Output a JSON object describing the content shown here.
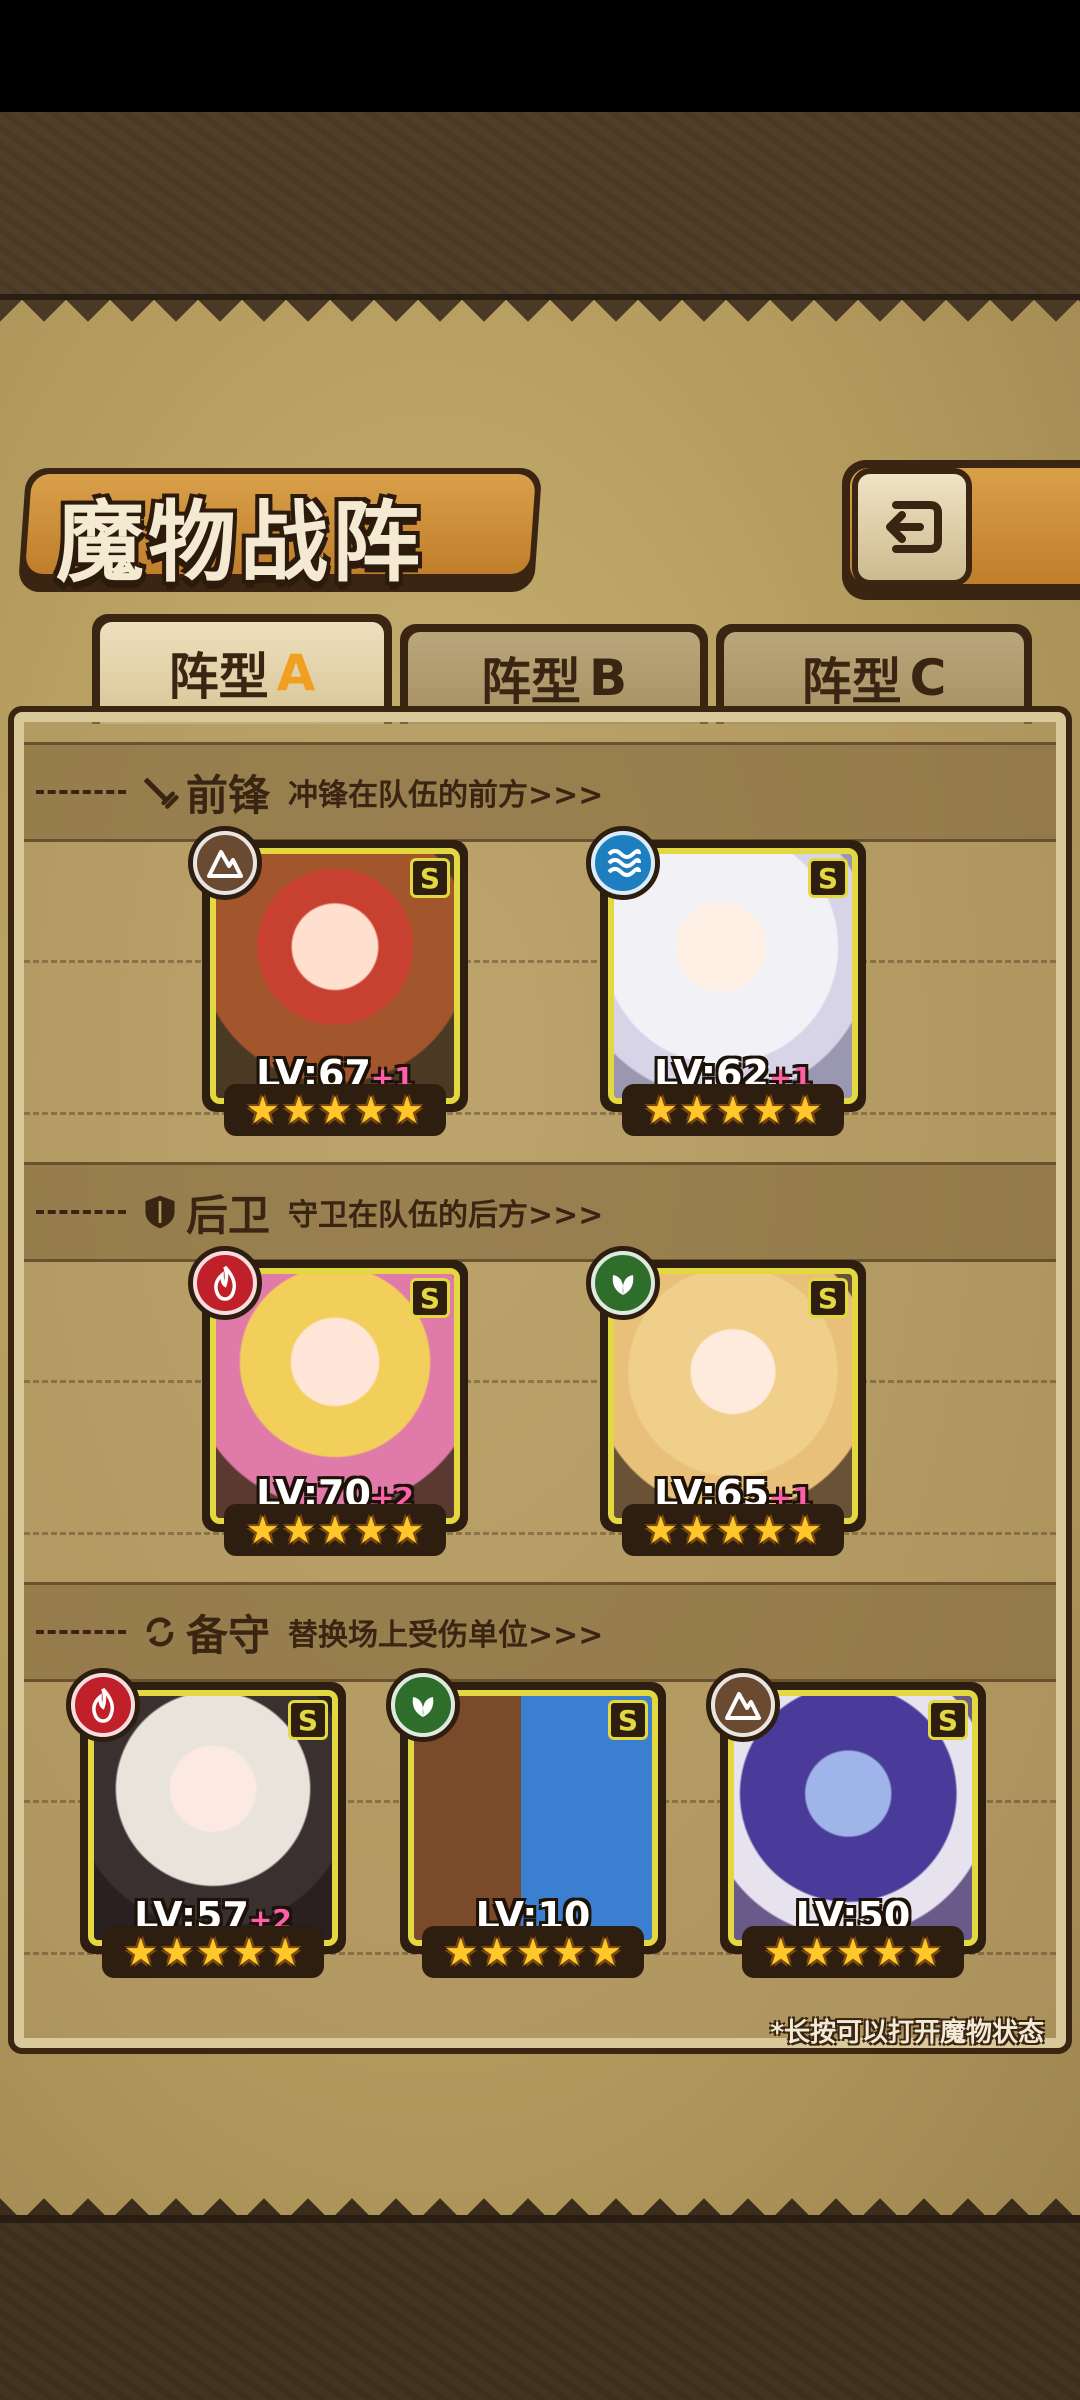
{
  "title": "魔物战阵",
  "tabs": [
    {
      "label": "阵型",
      "letter": "A",
      "active": true
    },
    {
      "label": "阵型",
      "letter": "B",
      "active": false
    },
    {
      "label": "阵型",
      "letter": "C",
      "active": false
    }
  ],
  "sections": {
    "front": {
      "name": "前锋",
      "desc": "冲锋在队伍的前方>>>",
      "icon": "sword-icon"
    },
    "rear": {
      "name": "后卫",
      "desc": "守卫在队伍的后方>>>",
      "icon": "shield-icon"
    },
    "reserve": {
      "name": "备守",
      "desc": "替换场上受伤单位>>>",
      "icon": "swap-icon"
    }
  },
  "monsters": {
    "front_1": {
      "rank": "S",
      "level": "LV:67",
      "bonus": "+1",
      "element": "earth-icon",
      "element_color": "#6b4a32",
      "stars": 5
    },
    "front_2": {
      "rank": "S",
      "level": "LV:62",
      "bonus": "+1",
      "element": "water-icon",
      "element_color": "#1e7fc0",
      "stars": 5
    },
    "rear_1": {
      "rank": "S",
      "level": "LV:70",
      "bonus": "+2",
      "element": "fire-icon",
      "element_color": "#c0202a",
      "stars": 5
    },
    "rear_2": {
      "rank": "S",
      "level": "LV:65",
      "bonus": "+1",
      "element": "wind-icon",
      "element_color": "#2e6e2a",
      "stars": 5
    },
    "reserve_1": {
      "rank": "S",
      "level": "LV:57",
      "bonus": "+2",
      "element": "fire-icon",
      "element_color": "#c0202a",
      "stars": 5
    },
    "reserve_2": {
      "rank": "S",
      "level": "LV:10",
      "bonus": "",
      "element": "wind-icon",
      "element_color": "#2e6e2a",
      "stars": 5
    },
    "reserve_3": {
      "rank": "S",
      "level": "LV:50",
      "bonus": "",
      "element": "earth-icon",
      "element_color": "#6b4a32",
      "stars": 5
    }
  },
  "footnote": "*长按可以打开魔物状态"
}
